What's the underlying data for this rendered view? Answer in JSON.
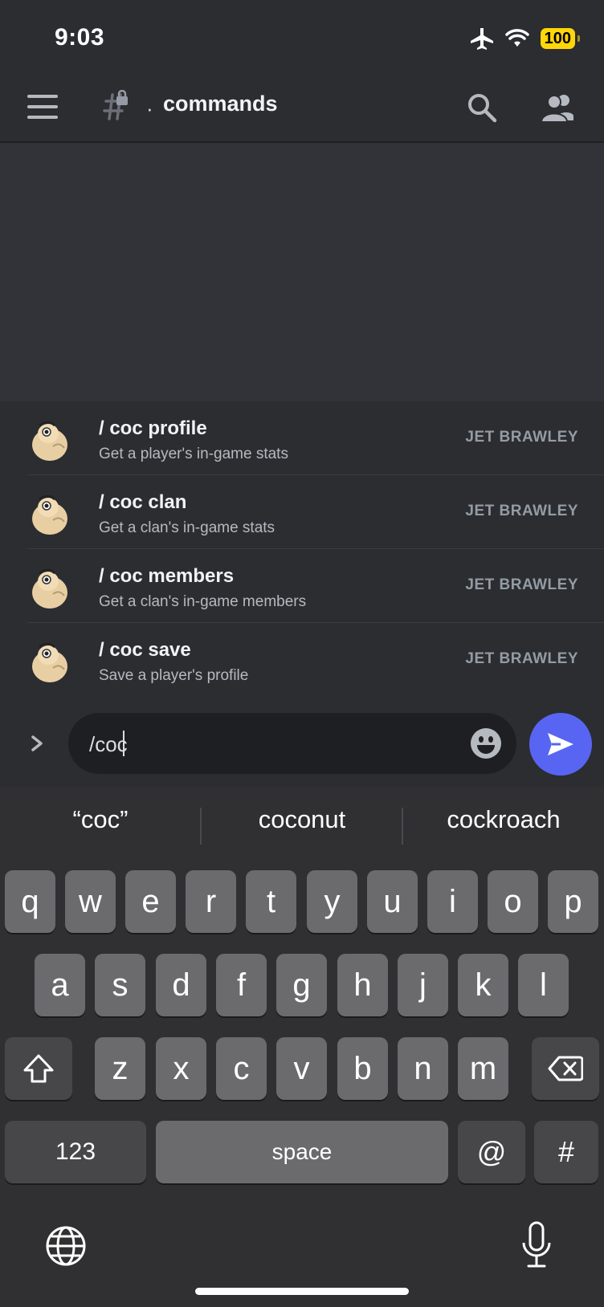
{
  "status_bar": {
    "time": "9:03",
    "battery": "100"
  },
  "header": {
    "channel_name": "commands"
  },
  "commands": [
    {
      "name": "/ coc profile",
      "description": "Get a player's in-game stats",
      "app": "JET BRAWLEY"
    },
    {
      "name": "/ coc clan",
      "description": "Get a clan's in-game stats",
      "app": "JET BRAWLEY"
    },
    {
      "name": "/ coc members",
      "description": "Get a clan's in-game members",
      "app": "JET BRAWLEY"
    },
    {
      "name": "/ coc save",
      "description": "Save a player's profile",
      "app": "JET BRAWLEY"
    }
  ],
  "composer": {
    "value": "/coc"
  },
  "keyboard": {
    "suggestions": [
      "“coc”",
      "coconut",
      "cockroach"
    ],
    "row1": [
      "q",
      "w",
      "e",
      "r",
      "t",
      "y",
      "u",
      "i",
      "o",
      "p"
    ],
    "row2": [
      "a",
      "s",
      "d",
      "f",
      "g",
      "h",
      "j",
      "k",
      "l"
    ],
    "row3": [
      "z",
      "x",
      "c",
      "v",
      "b",
      "n",
      "m"
    ],
    "numbers_key": "123",
    "space_key": "space",
    "at_key": "@",
    "hash_key": "#"
  },
  "colors": {
    "accent": "#5865f2",
    "battery": "#ffd60a"
  }
}
